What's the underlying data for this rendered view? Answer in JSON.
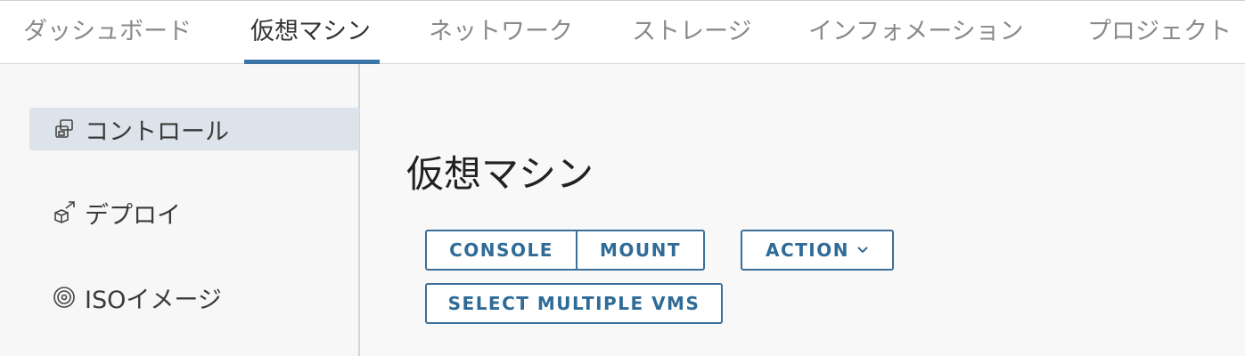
{
  "tabs": [
    {
      "label": "ダッシュボード"
    },
    {
      "label": "仮想マシン"
    },
    {
      "label": "ネットワーク"
    },
    {
      "label": "ストレージ"
    },
    {
      "label": "インフォメーション"
    },
    {
      "label": "プロジェクト"
    }
  ],
  "active_tab": "仮想マシン",
  "sidebar": {
    "items": [
      {
        "label": "コントロール",
        "icon": "vm-control-icon"
      },
      {
        "label": "デプロイ",
        "icon": "deploy-icon"
      },
      {
        "label": "ISOイメージ",
        "icon": "disc-icon"
      }
    ]
  },
  "main": {
    "title": "仮想マシン",
    "buttons": {
      "console": "CONSOLE",
      "mount": "MOUNT",
      "action": "ACTION",
      "select_multiple": "SELECT MULTIPLE VMS"
    }
  },
  "colors": {
    "accent": "#3b74a6",
    "button_text": "#2f6b97",
    "sidebar_active": "#dde3ea"
  }
}
